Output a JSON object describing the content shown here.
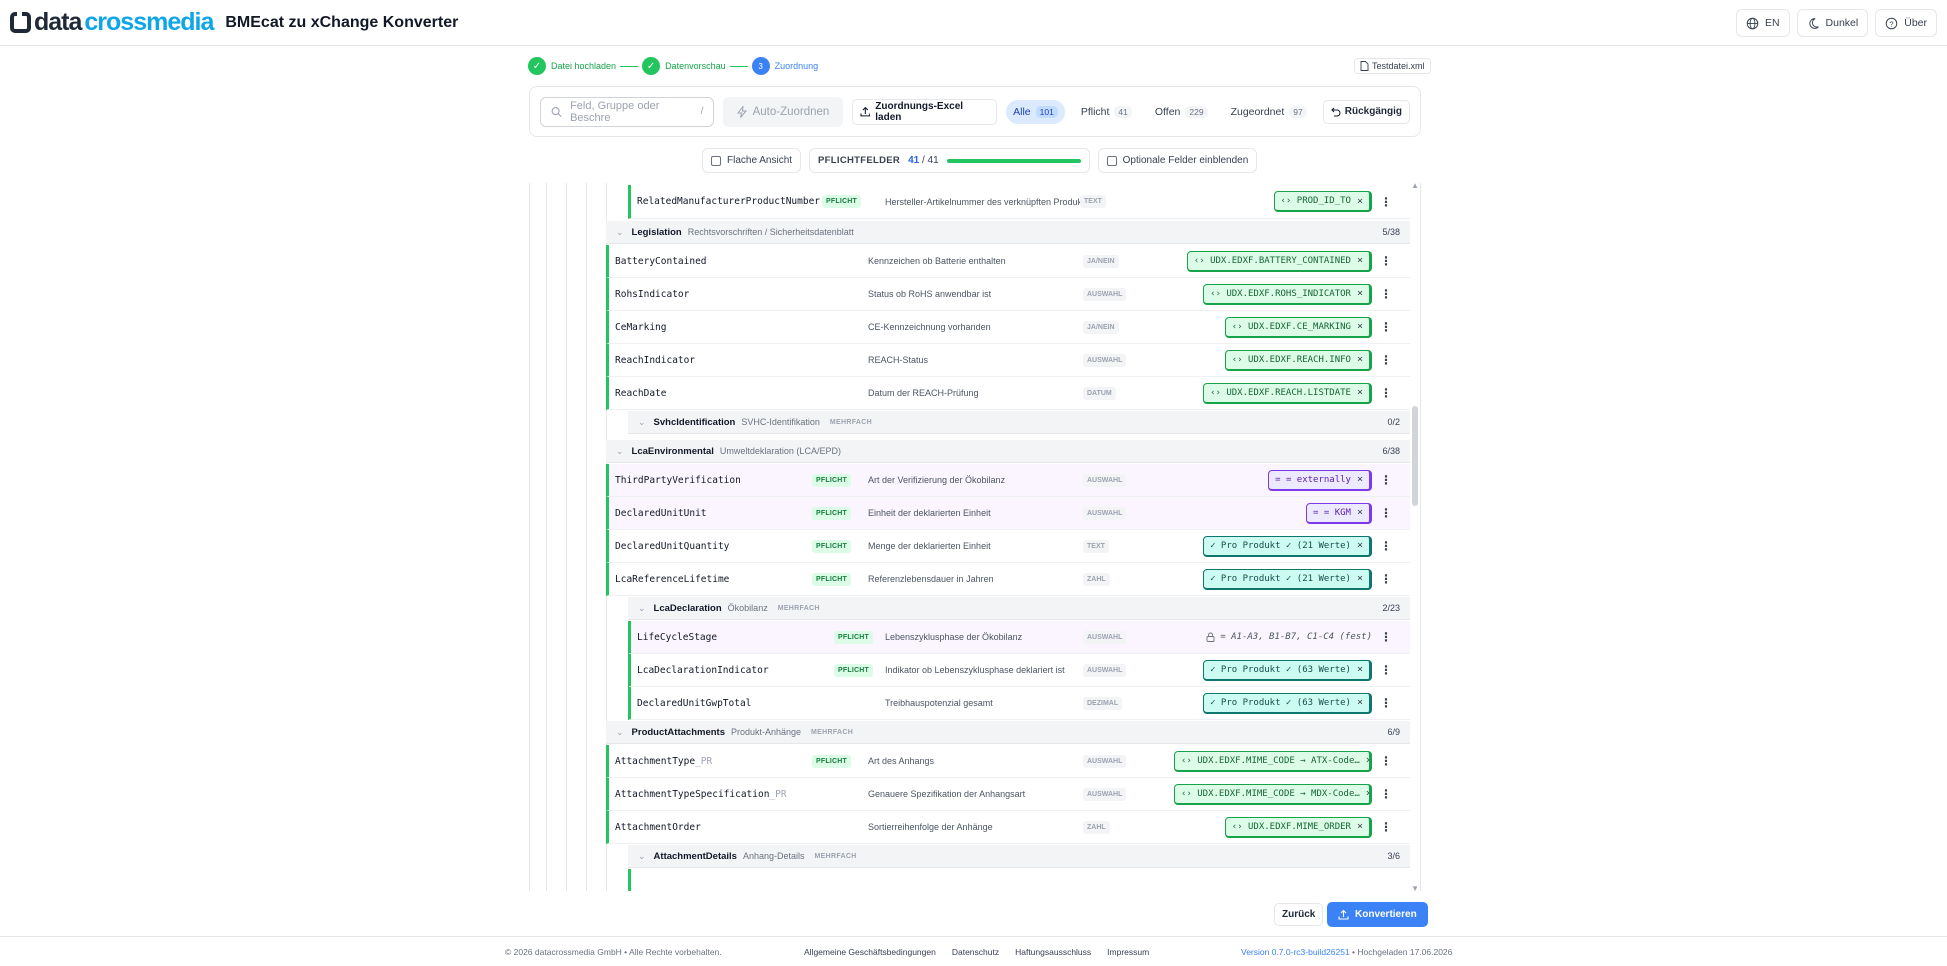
{
  "header": {
    "logo_a": "data",
    "logo_b": "crossmedia",
    "app_title": "BMEcat zu xChange Konverter",
    "lang": "EN",
    "theme": "Dunkel",
    "about": "Über"
  },
  "stepper": {
    "steps": [
      {
        "label": "Datei hochladen",
        "num": "✓"
      },
      {
        "label": "Datenvorschau",
        "num": "✓"
      },
      {
        "label": "Zuordnung",
        "num": "3"
      }
    ],
    "file": "Testdatei.xml"
  },
  "toolbar": {
    "search_placeholder": "Feld, Gruppe oder Beschre",
    "search_kbd": "/",
    "auto_map": "Auto-Zuordnen",
    "excel": "Zuordnungs-Excel laden",
    "tabs": [
      {
        "label": "Alle",
        "count": "101"
      },
      {
        "label": "Pflicht",
        "count": "41"
      },
      {
        "label": "Offen",
        "count": "229"
      },
      {
        "label": "Zugeordnet",
        "count": "97"
      }
    ],
    "undo": "Rückgängig"
  },
  "options": {
    "flat_view": "Flache Ansicht",
    "required_label": "PFLICHTFELDER",
    "required_done": "41",
    "required_sep": " / ",
    "required_total": "41",
    "required_progress": 1.0,
    "optional": "Optionale Felder einblenden"
  },
  "rows": [
    {
      "name": "RelatedManufacturerProductNumber",
      "pill": "PFLICHT",
      "desc": "Hersteller-Artikelnummer des verknüpften Produkts",
      "type": "TEXT",
      "map": "‹› PROD_ID_TO"
    },
    {
      "name": "BatteryContained",
      "desc": "Kennzeichen ob Batterie enthalten",
      "type": "JA/NEIN",
      "map": "‹› UDX.EDXF.BATTERY_CONTAINED"
    },
    {
      "name": "RohsIndicator",
      "desc": "Status ob RoHS anwendbar ist",
      "type": "AUSWAHL",
      "map": "‹› UDX.EDXF.ROHS_INDICATOR"
    },
    {
      "name": "CeMarking",
      "desc": "CE-Kennzeichnung vorhanden",
      "type": "JA/NEIN",
      "map": "‹› UDX.EDXF.CE_MARKING"
    },
    {
      "name": "ReachIndicator",
      "desc": "REACH-Status",
      "type": "AUSWAHL",
      "map": "‹› UDX.EDXF.REACH.INFO"
    },
    {
      "name": "ReachDate",
      "desc": "Datum der REACH-Prüfung",
      "type": "DATUM",
      "map": "‹› UDX.EDXF.REACH.LISTDATE"
    },
    {
      "name": "ThirdPartyVerification",
      "pill": "PFLICHT",
      "desc": "Art der Verifizierung der Ökobilanz",
      "type": "AUSWAHL",
      "map": "= = externally"
    },
    {
      "name": "DeclaredUnitUnit",
      "pill": "PFLICHT",
      "desc": "Einheit der deklarierten Einheit",
      "type": "AUSWAHL",
      "map": "= = KGM"
    },
    {
      "name": "DeclaredUnitQuantity",
      "pill": "PFLICHT",
      "desc": "Menge der deklarierten Einheit",
      "type": "TEXT",
      "map": "✓ Pro Produkt ✓ (21 Werte)"
    },
    {
      "name": "LcaReferenceLifetime",
      "pill": "PFLICHT",
      "desc": "Referenzlebensdauer in Jahren",
      "type": "ZAHL",
      "map": "✓ Pro Produkt ✓ (21 Werte)"
    },
    {
      "name": "LifeCycleStage",
      "pill": "PFLICHT",
      "desc": "Lebenszyklusphase der Ökobilanz",
      "type": "AUSWAHL",
      "map": "= A1-A3, B1-B7, C1-C4 (fest)"
    },
    {
      "name": "LcaDeclarationIndicator",
      "pill": "PFLICHT",
      "desc": "Indikator ob Lebenszyklusphase deklariert ist",
      "type": "AUSWAHL",
      "map": "✓ Pro Produkt ✓ (63 Werte)"
    },
    {
      "name": "DeclaredUnitGwpTotal",
      "desc": "Treibhauspotenzial gesamt",
      "type": "DEZIMAL",
      "map": "✓ Pro Produkt ✓ (63 Werte)"
    },
    {
      "name": "AttachmentType",
      "suffix": "_PR",
      "pill": "PFLICHT",
      "desc": "Art des Anhangs",
      "type": "AUSWAHL",
      "map": "‹› UDX.EDXF.MIME_CODE → ATX-Code…"
    },
    {
      "name": "AttachmentTypeSpecification",
      "suffix": "_PR",
      "desc": "Genauere Spezifikation der Anhangsart",
      "type": "AUSWAHL",
      "map": "‹› UDX.EDXF.MIME_CODE → MDX-Code…"
    },
    {
      "name": "AttachmentOrder",
      "desc": "Sortierreihenfolge der Anhänge",
      "type": "ZAHL",
      "map": "‹› UDX.EDXF.MIME_ORDER"
    }
  ],
  "groups": [
    {
      "name": "Legislation",
      "desc": "Rechtsvorschriften / Sicherheitsdatenblatt",
      "count": "5/38"
    },
    {
      "name": "SvhcIdentification",
      "desc": "SVHC-Identifikation",
      "multi": "MEHRFACH",
      "count": "0/2"
    },
    {
      "name": "LcaEnvironmental",
      "desc": "Umweltdeklaration (LCA/EPD)",
      "count": "6/38"
    },
    {
      "name": "LcaDeclaration",
      "desc": "Ökobilanz",
      "multi": "MEHRFACH",
      "count": "2/23"
    },
    {
      "name": "ProductAttachments",
      "desc": "Produkt-Anhänge",
      "multi": "MEHRFACH",
      "count": "6/9"
    },
    {
      "name": "AttachmentDetails",
      "desc": "Anhang-Details",
      "multi": "MEHRFACH",
      "count": "3/6"
    }
  ],
  "actions": {
    "back": "Zurück",
    "convert": "Konvertieren"
  },
  "footer": {
    "copyright": "© 2026 datacrossmedia GmbH • Alle Rechte vorbehalten.",
    "links": [
      "Allgemeine Geschäftsbedingungen",
      "Datenschutz",
      "Haftungsausschluss",
      "Impressum"
    ],
    "version": "Version 0.7.0-rc3-build26251",
    "uploaded": " • Hochgeladen 17.06.2026"
  }
}
